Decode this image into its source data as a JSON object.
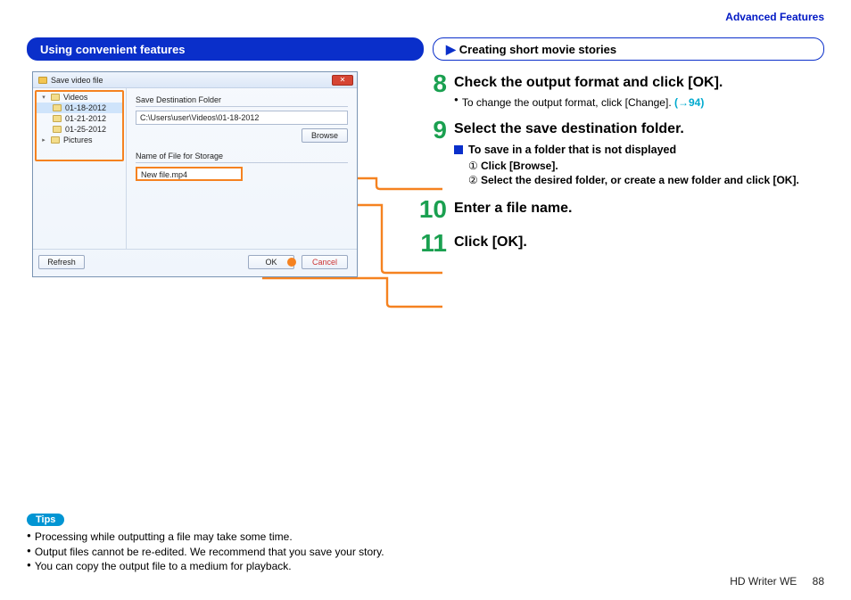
{
  "header": {
    "section_link": "Advanced Features"
  },
  "tabs": {
    "left": "Using convenient features",
    "right": "Creating short movie stories"
  },
  "dialog": {
    "title": "Save video file",
    "tree": {
      "root": "Videos",
      "items": [
        "01-18-2012",
        "01-21-2012",
        "01-25-2012"
      ],
      "root2": "Pictures"
    },
    "dest_label": "Save Destination Folder",
    "path": "C:\\Users\\user\\Videos\\01-18-2012",
    "browse": "Browse",
    "name_label": "Name of File for Storage",
    "filename": "New file.mp4",
    "refresh": "Refresh",
    "ok": "OK",
    "cancel": "Cancel"
  },
  "steps": {
    "s8": {
      "num": "8",
      "title": "Check the output format and click [OK].",
      "bullet": "To change the output format, click [Change]. ",
      "link": "(→94)"
    },
    "s9": {
      "num": "9",
      "title": "Select the save destination folder.",
      "subhead": "To save in a folder that is not displayed",
      "i1_num": "①",
      "i1": "Click [Browse].",
      "i2_num": "②",
      "i2": "Select the desired folder, or create a new folder and click [OK]."
    },
    "s10": {
      "num": "10",
      "title": "Enter a file name."
    },
    "s11": {
      "num": "11",
      "title": "Click [OK]."
    }
  },
  "tips": {
    "label": "Tips",
    "t1": "Processing while outputting a file may take some time.",
    "t2": "Output files cannot be re-edited. We recommend that you save your story.",
    "t3": "You can copy the output file to a medium for playback."
  },
  "footer": {
    "product": "HD Writer WE",
    "page": "88"
  }
}
